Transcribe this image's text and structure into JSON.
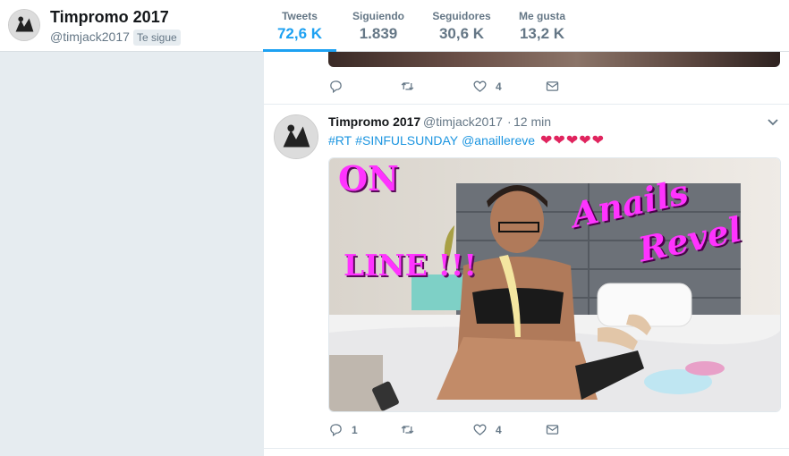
{
  "profile": {
    "name": "Timpromo 2017",
    "handle": "@timjack2017",
    "follows_you": "Te sigue"
  },
  "stats": [
    {
      "label": "Tweets",
      "value": "72,6 K"
    },
    {
      "label": "Siguiendo",
      "value": "1.839"
    },
    {
      "label": "Seguidores",
      "value": "30,6 K"
    },
    {
      "label": "Me gusta",
      "value": "13,2 K"
    }
  ],
  "previous_tweet": {
    "actions": {
      "reply": "",
      "retweet": "",
      "like": "4"
    }
  },
  "tweet": {
    "name": "Timpromo 2017",
    "handle": "@timjack2017",
    "separator": "·",
    "time": "12 min",
    "text": {
      "hashtag1": "#RT",
      "hashtag2": "#SINFULSUNDAY",
      "mention": "@anaillereve",
      "hearts": "❤❤❤❤❤"
    },
    "media_overlay": {
      "on": "ON",
      "line": "LINE !!!",
      "name1": "Anails",
      "name2": "Revel"
    },
    "actions": {
      "reply": "1",
      "retweet": "",
      "like": "4"
    }
  },
  "colors": {
    "accent": "#1da1f2",
    "link": "#1b95e0",
    "heart": "#e0245e",
    "muted": "#657786",
    "overlay_magenta": "#ff33ff"
  },
  "icons": [
    "reply-icon",
    "retweet-icon",
    "like-icon",
    "direct-message-icon",
    "caret-down-icon"
  ]
}
